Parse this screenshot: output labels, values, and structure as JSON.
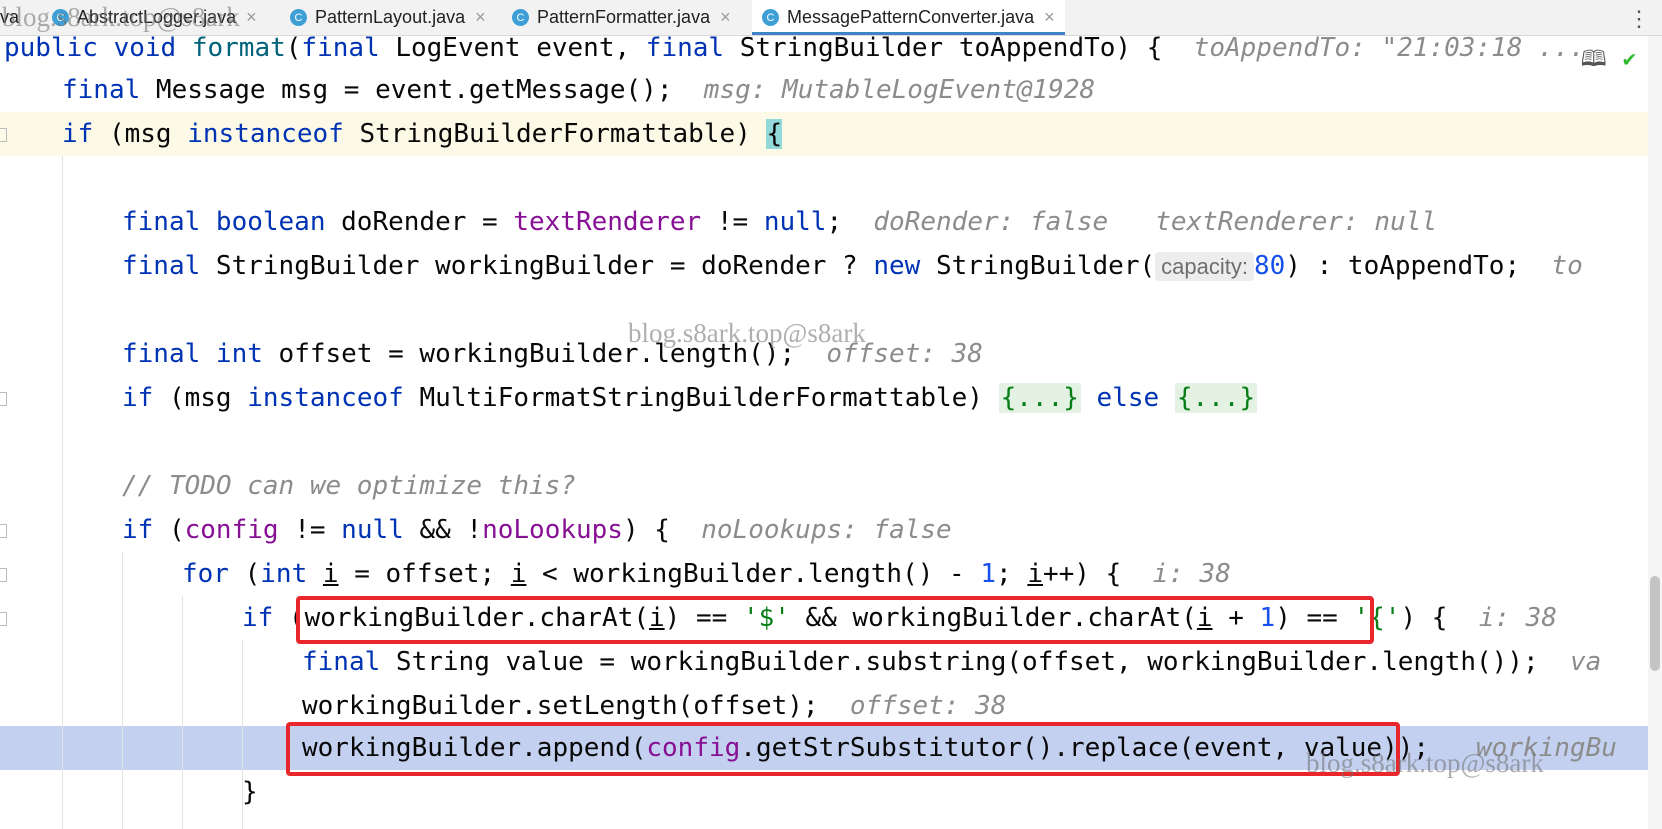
{
  "tabs": [
    {
      "label": "va",
      "close": "",
      "icon": "",
      "active": false
    },
    {
      "label": "AbstractLogger.java",
      "close": "×",
      "icon": "C",
      "active": false
    },
    {
      "label": "PatternLayout.java",
      "close": "×",
      "icon": "C",
      "active": false
    },
    {
      "label": "PatternFormatter.java",
      "close": "×",
      "icon": "C",
      "active": false
    },
    {
      "label": "MessagePatternConverter.java",
      "close": "×",
      "icon": "C",
      "active": true
    }
  ],
  "menu_icon": "⋮",
  "right_icons": {
    "reader": "reader-mode-icon",
    "check": "✔"
  },
  "watermarks": [
    "blog.s8ark.top@s8ark",
    "blog.s8ark.top@s8ark",
    "blog.s8ark.top@s8ark"
  ],
  "code": {
    "l1": {
      "a": "public void ",
      "b": "format",
      "c": "(",
      "d": "final ",
      "e": "LogEvent event, ",
      "f": "final ",
      "g": "StringBuilder toAppendTo) {",
      "h": "toAppendTo: \"21:03:18 ..."
    },
    "l2": {
      "a": "final ",
      "b": "Message msg = event.getMessage();",
      "h": "msg: MutableLogEvent@1928"
    },
    "l3": {
      "a": "if ",
      "b": "(msg ",
      "c": "instanceof ",
      "d": "StringBuilderFormattable) ",
      "e": "{"
    },
    "l4": {
      "a": "final boolean ",
      "b": "doRender = ",
      "c": "textRenderer",
      "d": " != ",
      "e": "null",
      "f": ";",
      "h1": "doRender: false",
      "h2": "textRenderer: null"
    },
    "l5": {
      "a": "final ",
      "b": "StringBuilder workingBuilder = doRender ? ",
      "c": "new ",
      "d": "StringBuilder(",
      "inlay": "capacity:",
      "e": "80",
      "f": ") : toAppendTo;",
      "h": "to"
    },
    "l6": {
      "a": "final int ",
      "b": "offset = workingBuilder.length();",
      "h": "offset: 38"
    },
    "l7": {
      "a": "if ",
      "b": "(msg ",
      "c": "instanceof ",
      "d": "MultiFormatStringBuilderFormattable) ",
      "e": "{...}",
      "f": " else ",
      "g": "{...}"
    },
    "l8": {
      "a": "// TODO can we optimize this?"
    },
    "l9": {
      "a": "if ",
      "b": "(",
      "c": "config",
      "d": " != ",
      "e": "null",
      "f": " && !",
      "g": "noLookups",
      "hh": ") {",
      "h": "noLookups: false"
    },
    "l10": {
      "a": "for ",
      "b": "(",
      "c": "int ",
      "d": "i",
      "e": " = offset; ",
      "f": "i",
      "g": " < workingBuilder.length() - ",
      "n": "1",
      "j": "; ",
      "k": "i",
      "m": "++) {",
      "h": "i: 38"
    },
    "l11": {
      "a": "if ",
      "b": "(workingBuilder.charAt(",
      "c": "i",
      "d": ") == ",
      "e": "'$'",
      "f": " && workingBuilder.charAt(",
      "g": "i",
      "hh": " + ",
      "n": "1",
      "j": ") == ",
      "k": "'{'",
      "m": ") {",
      "h": "i: 38"
    },
    "l12": {
      "a": "final ",
      "b": "String value = workingBuilder.substring(offset, workingBuilder.length());",
      "h": "va"
    },
    "l13": {
      "a": "workingBuilder.setLength(offset);",
      "h": "offset: 38"
    },
    "l14": {
      "a": "workingBuilder.append(",
      "b": "config",
      "c": ".getStrSubstitutor().replace(event, value));",
      "h": "workingBu"
    },
    "l15": {
      "a": "}"
    }
  },
  "colors": {
    "keyword": "#0033b3",
    "field": "#871094",
    "number": "#1750eb",
    "string": "#067d17",
    "hint": "#8c8c8c",
    "highlight_line": "#fcfae6",
    "exec_line": "#c3d0ef",
    "red_box": "#e8262b"
  }
}
